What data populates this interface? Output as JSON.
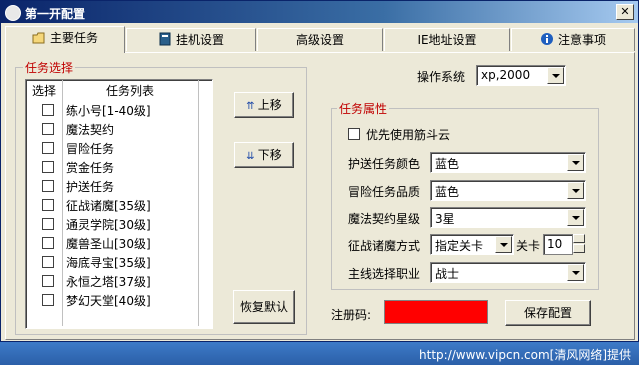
{
  "window": {
    "title": "第一开配置",
    "close_label": "✕"
  },
  "tabs": [
    {
      "label": "主要任务",
      "icon": "folder-icon"
    },
    {
      "label": "挂机设置",
      "icon": "book-icon"
    },
    {
      "label": "高级设置"
    },
    {
      "label": "IE地址设置"
    },
    {
      "label": "注意事项",
      "icon": "info-icon"
    }
  ],
  "task_select": {
    "legend": "任务选择",
    "col_select": "选择",
    "col_list": "任务列表",
    "items": [
      "练小号[1-40级]",
      "魔法契约",
      "冒险任务",
      "赏金任务",
      "护送任务",
      "征战诸魔[35级]",
      "通灵学院[30级]",
      "魔兽圣山[30级]",
      "海底寻宝[35级]",
      "永恒之塔[37级]",
      "梦幻天堂[40级]"
    ]
  },
  "buttons": {
    "up": "上移",
    "down": "下移",
    "restore": "恢复默认",
    "save": "保存配置"
  },
  "os": {
    "label": "操作系统",
    "value": "xp,2000"
  },
  "task_props": {
    "legend": "任务属性",
    "priority_label": "优先使用筋斗云",
    "escort_color_label": "护送任务颜色",
    "escort_color": "蓝色",
    "adventure_quality_label": "冒险任务品质",
    "adventure_quality": "蓝色",
    "contract_star_label": "魔法契约星级",
    "contract_star": "3星",
    "conquest_mode_label": "征战诸魔方式",
    "conquest_mode": "指定关卡",
    "stage_label": "关卡",
    "stage_value": "10",
    "main_job_label": "主线选择职业",
    "main_job": "战士"
  },
  "register": {
    "label": "注册码:",
    "color": "#ff0000"
  },
  "status": {
    "text": "http://www.vipcn.com[清风网络]提供"
  }
}
